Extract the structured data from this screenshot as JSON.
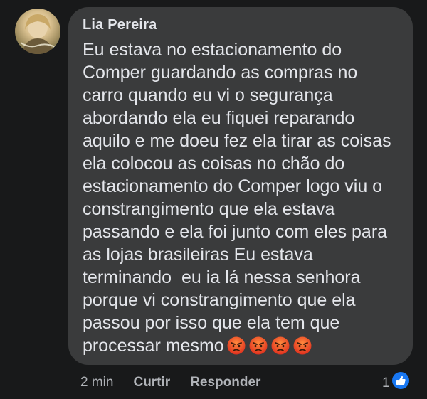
{
  "comment": {
    "author": "Lia Pereira",
    "text": "Eu estava no estacionamento do\nComper guardando as compras no\ncarro quando eu vi o segurança\nabordando ela eu fiquei reparando\naquilo e me doeu fez ela tirar as coisas\nela colocou as coisas no chão do\nestacionamento do Comper logo viu o\nconstrangimento que ela estava\npassando e ela foi junto com eles para\nas lojas brasileiras Eu estava\nterminando  eu ia lá nessa senhora\nporque vi constrangimento que ela\npassou por isso que ela tem que\nprocessar mesmo",
    "emojis": [
      "angry-face-icon",
      "angry-face-icon",
      "angry-face-icon",
      "angry-face-icon"
    ]
  },
  "actions": {
    "time": "2 min",
    "like_label": "Curtir",
    "reply_label": "Responder"
  },
  "reactions": {
    "count": "1",
    "type": "like-icon"
  },
  "colors": {
    "background": "#18191a",
    "bubble": "#3a3b3c",
    "text": "#e4e6eb",
    "secondary_text": "#b0b3b8",
    "like_blue": "#1877f2"
  }
}
